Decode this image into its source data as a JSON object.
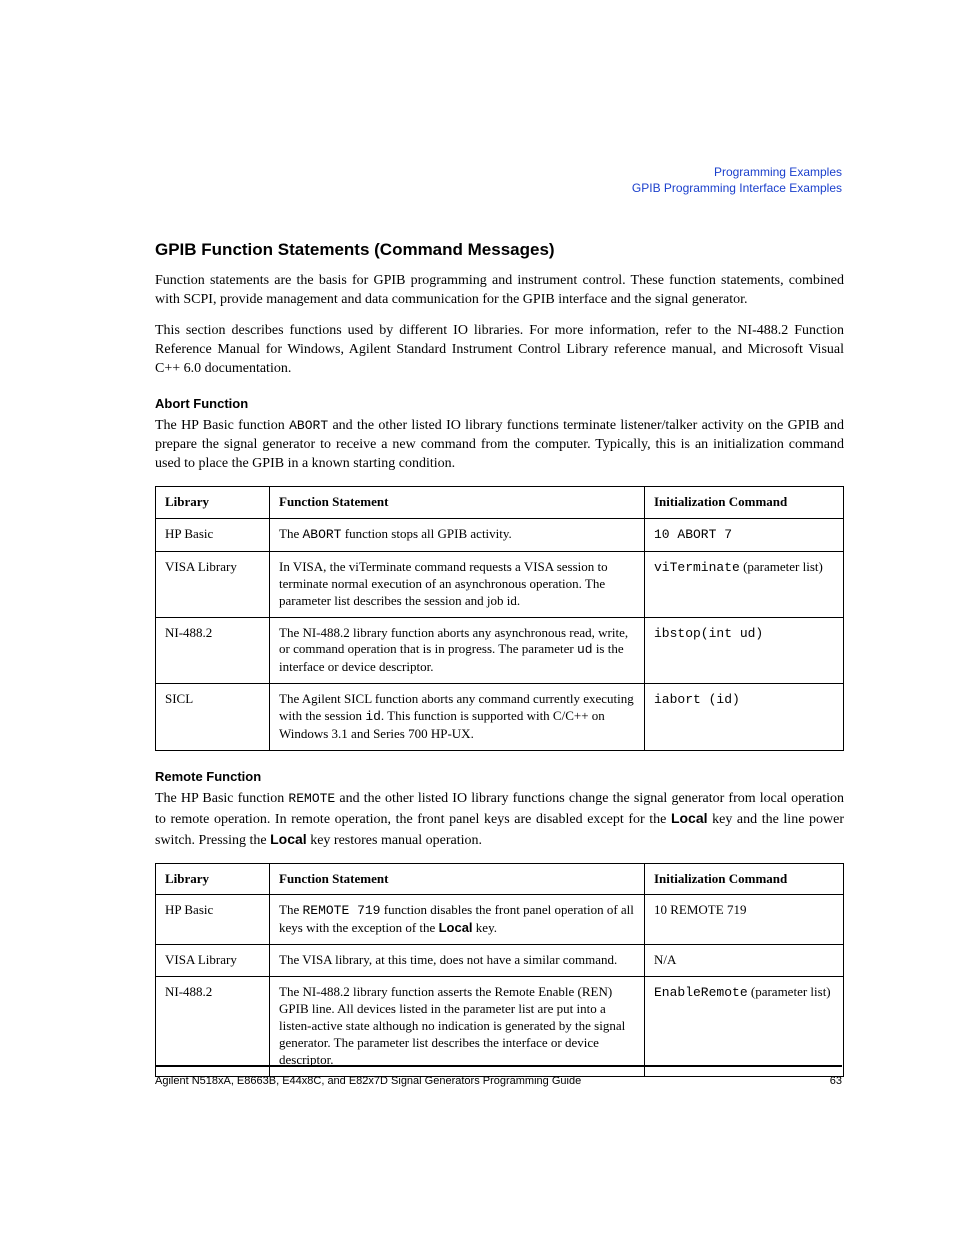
{
  "header": {
    "line1": "Programming Examples",
    "line2": "GPIB Programming Interface Examples"
  },
  "title": "GPIB Function Statements (Command Messages)",
  "para1": "Function statements are the basis for GPIB programming and instrument control. These function statements, combined with SCPI, provide management and data communication for the GPIB interface and the signal generator.",
  "para2": "This section describes functions used by different IO libraries. For more information, refer to the NI-488.2 Function Reference Manual for Windows, Agilent Standard Instrument Control Library reference manual, and Microsoft Visual C++ 6.0 documentation.",
  "abort": {
    "heading": "Abort Function",
    "intro_pre": "The HP Basic function ",
    "intro_code": "ABORT",
    "intro_post": " and the other listed IO library functions terminate listener/talker activity on the GPIB and prepare the signal generator to receive a new command from the computer. Typically, this is an initialization command used to place the GPIB in a known starting condition.",
    "cols": [
      "Library",
      "Function Statement",
      "Initialization Command"
    ],
    "rows": [
      {
        "lib": "HP Basic",
        "stmt_pre": "The ",
        "stmt_code": "ABORT",
        "stmt_post": " function stops all GPIB activity.",
        "init_code": "10 ABORT 7",
        "init_post": ""
      },
      {
        "lib": "VISA Library",
        "stmt_pre": "In VISA, the viTerminate command requests a VISA session to terminate normal execution of an asynchronous operation. The parameter list describes the session and job id.",
        "stmt_code": "",
        "stmt_post": "",
        "init_code": "viTerminate",
        "init_post": " (parameter list)"
      },
      {
        "lib": "NI-488.2",
        "stmt_pre": "The NI-488.2 library function aborts any asynchronous read, write, or command operation that is in progress. The parameter ",
        "stmt_code": "ud",
        "stmt_post": " is the interface or device descriptor.",
        "init_code": "ibstop(int ud)",
        "init_post": ""
      },
      {
        "lib": "SICL",
        "stmt_pre": "The Agilent SICL function aborts any command currently executing with the session ",
        "stmt_code": "id",
        "stmt_post": ". This function is supported with C/C++ on Windows 3.1 and Series 700 HP-UX.",
        "init_code": "iabort (id)",
        "init_post": ""
      }
    ]
  },
  "remote": {
    "heading": "Remote Function",
    "intro_pre": "The HP Basic function ",
    "intro_code": "REMOTE",
    "intro_mid1": " and the other listed IO library functions change the signal generator from local operation to remote operation. In remote operation, the front panel keys are disabled except for the ",
    "intro_key1": "Local",
    "intro_mid2": " key and the line power switch. Pressing the ",
    "intro_key2": "Local",
    "intro_post": " key restores manual operation.",
    "cols": [
      "Library",
      "Function Statement",
      "Initialization Command"
    ],
    "rows": [
      {
        "lib": "HP Basic",
        "stmt_pre": "The ",
        "stmt_code": "REMOTE 719",
        "stmt_mid": " function disables the front panel operation of all keys with the exception of the ",
        "stmt_key": "Local",
        "stmt_post": " key.",
        "init": "10 REMOTE 719",
        "init_code": "",
        "init_post": ""
      },
      {
        "lib": "VISA Library",
        "stmt_pre": "The VISA library, at this time, does not have a similar command.",
        "stmt_code": "",
        "stmt_mid": "",
        "stmt_key": "",
        "stmt_post": "",
        "init": "N/A",
        "init_code": "",
        "init_post": ""
      },
      {
        "lib": "NI-488.2",
        "stmt_pre": "The NI-488.2 library function asserts the Remote Enable (REN) GPIB line. All devices listed in the parameter list are put into a listen-active state although no indication is generated by the signal generator. The parameter list describes the interface or device descriptor.",
        "stmt_code": "",
        "stmt_mid": "",
        "stmt_key": "",
        "stmt_post": "",
        "init": "",
        "init_code": "EnableRemote",
        "init_post": " (parameter list)"
      }
    ]
  },
  "footer": {
    "left": "Agilent N518xA, E8663B, E44x8C, and E82x7D Signal Generators Programming Guide",
    "right": "63"
  }
}
